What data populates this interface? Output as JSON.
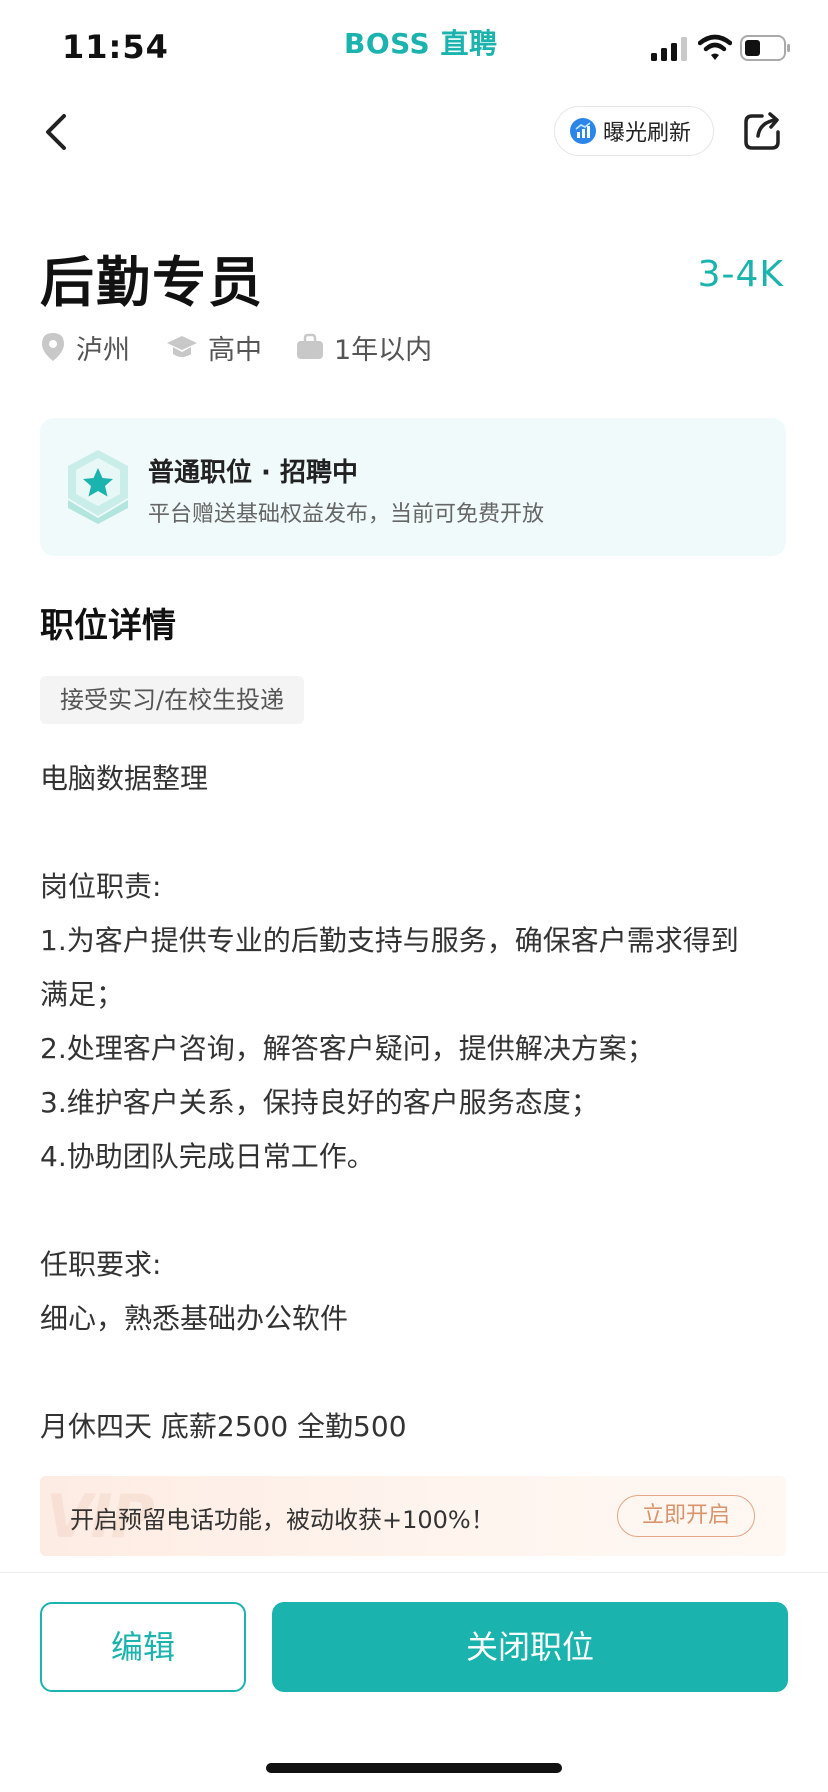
{
  "status_bar": {
    "time": "11:54",
    "brand": "BOSS 直聘"
  },
  "nav": {
    "refresh_label": "曝光刷新"
  },
  "job": {
    "title": "后勤专员",
    "salary": "3-4K",
    "location": "泸州",
    "education": "高中",
    "experience": "1年以内"
  },
  "status_card": {
    "title": "普通职位 · 招聘中",
    "subtitle": "平台赠送基础权益发布，当前可免费开放"
  },
  "details": {
    "heading": "职位详情",
    "tag": "接受实习/在校生投递",
    "lines": [
      "电脑数据整理",
      "",
      "岗位职责:",
      "1.为客户提供专业的后勤支持与服务，确保客户需求得到",
      "满足；",
      "2.处理客户咨询，解答客户疑问，提供解决方案；",
      "3.维护客户关系，保持良好的客户服务态度；",
      "4.协助团队完成日常工作。",
      "",
      "任职要求:",
      "细心，熟悉基础办公软件",
      "",
      "月休四天  底薪2500 全勤500"
    ]
  },
  "promo": {
    "watermark": "VIP",
    "text": "开启预留电话功能，被动收获+100%！",
    "button": "立即开启"
  },
  "bottom": {
    "edit_label": "编辑",
    "close_label": "关闭职位"
  },
  "colors": {
    "accent": "#1bb3ae",
    "promo_accent": "#d9946c"
  },
  "icons": [
    "chevron-left-icon",
    "refresh-chart-icon",
    "share-icon",
    "location-pin-icon",
    "graduation-cap-icon",
    "briefcase-icon",
    "star-badge-icon"
  ]
}
